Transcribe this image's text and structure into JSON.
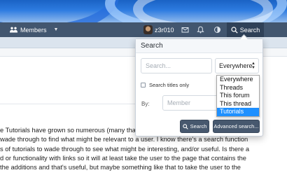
{
  "navbar": {
    "members_label": "Members",
    "username": "z3r010",
    "search_label": "Search",
    "icons": [
      "users-icon",
      "chevron-down-icon",
      "envelope-icon",
      "bell-icon",
      "theme-toggle-icon",
      "search-icon"
    ]
  },
  "search_popup": {
    "title": "Search",
    "keywords_placeholder": "Search...",
    "scope_selected": "Everywhere",
    "scope_options": [
      {
        "label": "Everywhere",
        "selected": false
      },
      {
        "label": "Threads",
        "selected": false
      },
      {
        "label": "This forum",
        "selected": false
      },
      {
        "label": "This thread",
        "selected": false
      },
      {
        "label": "Tutorials",
        "selected": true
      }
    ],
    "titles_only_label": "Search titles only",
    "titles_only_checked": false,
    "by_label": "By:",
    "member_placeholder": "Member",
    "search_button": "Search",
    "advanced_button": "Advanced search..."
  },
  "post": {
    "lines": [
      "e Tutorials have grown so numerous (many tha",
      "wade through to find what might be relevant to a user. I know there's a search function",
      "s of tutorials to wade through to see what might be interesting, and/or useful. Is there a",
      "d or functionality with links so it will at least take the user to the page that contains the",
      "the additions and that's useful, but maybe something like that to take the user to the",
      "                                               "
    ]
  },
  "colors": {
    "navbar": "#42566f",
    "search_active": "#2f4158",
    "button": "#47586e",
    "selected_option": "#1e90ff"
  }
}
